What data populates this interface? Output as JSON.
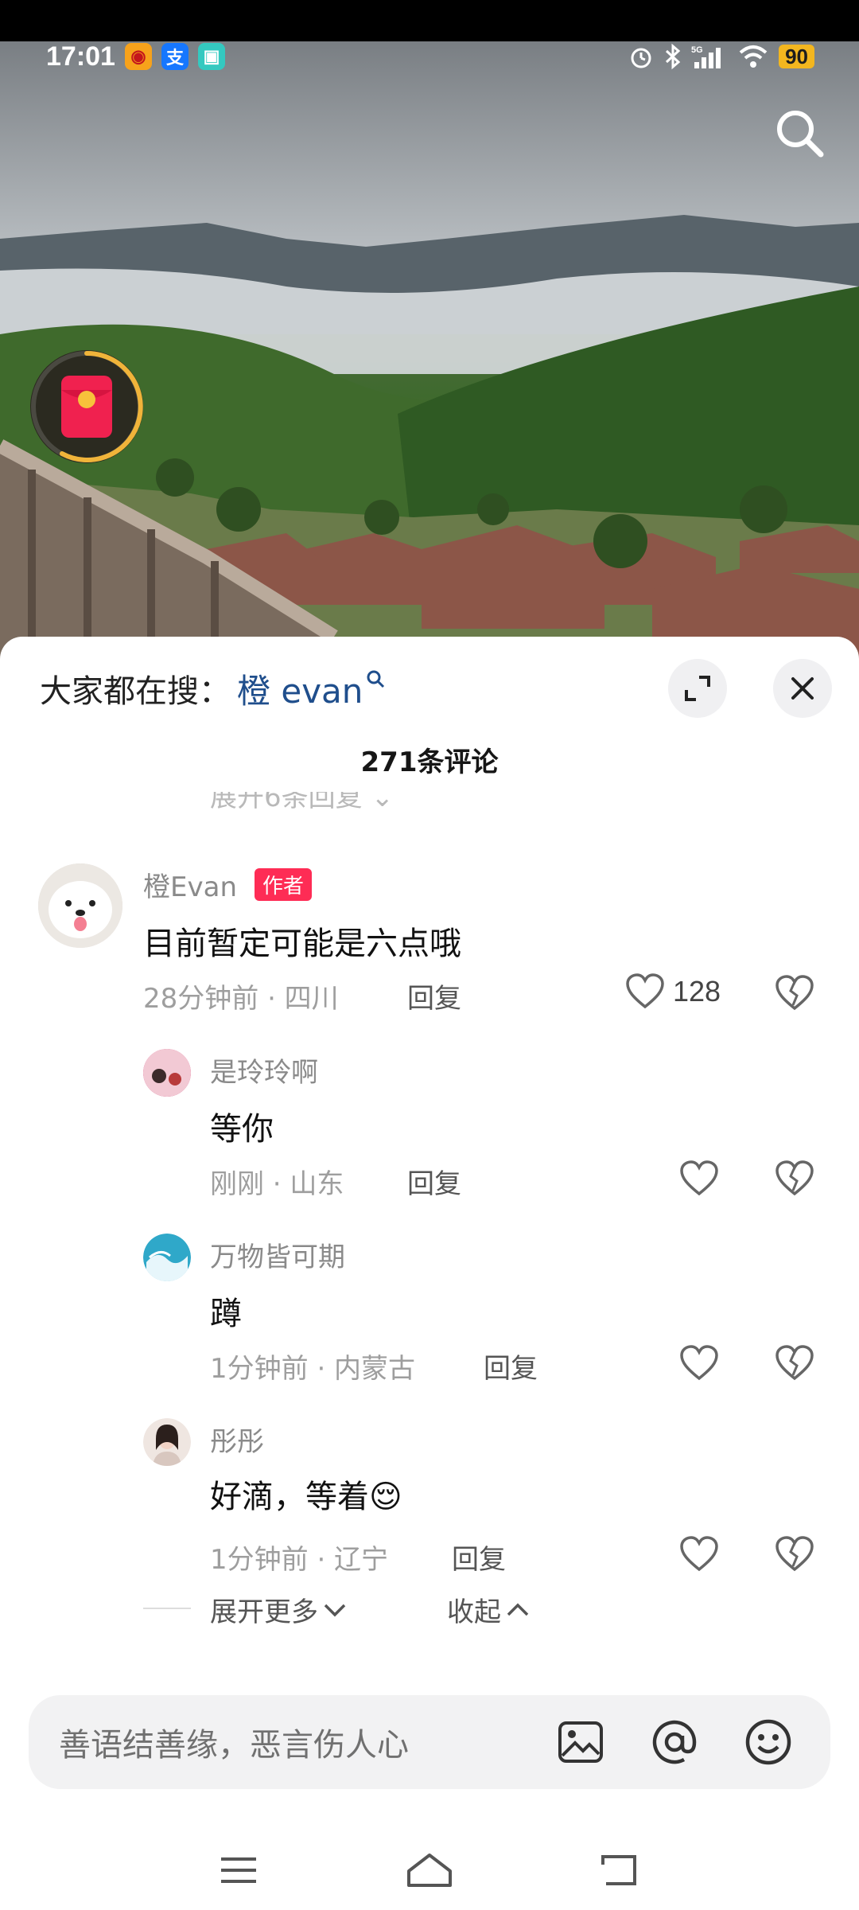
{
  "status_bar": {
    "time": "17:01",
    "apps": [
      {
        "icon": "weibo-icon",
        "color": "#f7a21b",
        "glyph": "◉"
      },
      {
        "icon": "alipay-icon",
        "color": "#1677ff",
        "glyph": "支"
      },
      {
        "icon": "app-icon",
        "color": "#34c9c0",
        "glyph": "▣"
      }
    ],
    "network": "5G",
    "battery": "90"
  },
  "sheet": {
    "hot_search_prefix": "大家都在搜：",
    "hot_search_term": "橙 evan",
    "comment_count": "271条评论",
    "collapsed_hint": "展开6条回复 ⌄"
  },
  "comments": [
    {
      "name": "橙Evan",
      "tag": "作者",
      "text": "目前暂定可能是六点哦",
      "meta": "28分钟前 · 四川",
      "reply": "回复",
      "likes": "128"
    },
    {
      "name": "是玲玲啊",
      "text": "等你",
      "meta": "刚刚 · 山东",
      "reply": "回复",
      "avatar_color": "#e0578a"
    },
    {
      "name": "万物皆可期",
      "text": "蹲",
      "meta": "1分钟前 · 内蒙古",
      "reply": "回复",
      "avatar_color": "#2fa8c9"
    },
    {
      "name": "彤彤",
      "text": "好滴，等着😌",
      "meta": "1分钟前 · 辽宁",
      "reply": "回复",
      "avatar_color": "#d8c7bf"
    }
  ],
  "expand": {
    "more": "展开更多",
    "collapse": "收起"
  },
  "input": {
    "placeholder": "善语结善缘，恶言伤人心",
    "icons": [
      "image-icon",
      "at-icon",
      "emoji-icon"
    ]
  },
  "nav": [
    "menu-icon",
    "home-icon",
    "back-icon"
  ]
}
